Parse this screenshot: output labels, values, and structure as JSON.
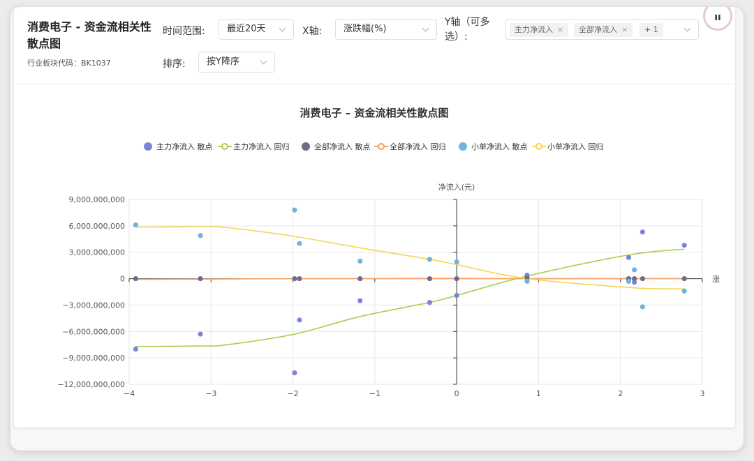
{
  "header": {
    "title": "消费电子 - 资金流相关性散点图",
    "subtitle": "行业板块代码：BK1037",
    "avatar_text": "ıı"
  },
  "filters": {
    "time_label": "时间范围:",
    "time_value": "最近20天",
    "x_label": "X轴:",
    "x_value": "涨跌幅(%)",
    "y_label": "Y轴（可多选）:",
    "y_tags": [
      "主力净流入",
      "全部净流入"
    ],
    "y_more": "+ 1",
    "sort_label": "排序:",
    "sort_value": "按Y降序"
  },
  "colors": {
    "main_scatter": "#7b85d8",
    "main_reg": "#a8cf4e",
    "all_scatter": "#6e6d85",
    "all_reg": "#f4a161",
    "small_scatter": "#6db4de",
    "small_reg": "#f3d651"
  },
  "chart_data": {
    "type": "scatter",
    "title": "消费电子 – 资金流相关性散点图",
    "ylabel": "净流入(元)",
    "xlabel": "涨",
    "xlim": [
      -4,
      3
    ],
    "ylim": [
      -12000000000,
      9000000000
    ],
    "xticks": [
      -4,
      -3,
      -2,
      -1,
      0,
      1,
      2,
      3
    ],
    "xtick_labels": [
      "−4",
      "−3",
      "−2",
      "−1",
      "0",
      "1",
      "2",
      "3"
    ],
    "yticks": [
      9000000000,
      6000000000,
      3000000000,
      0,
      -3000000000,
      -6000000000,
      -9000000000,
      -12000000000
    ],
    "ytick_labels": [
      "9,000,000,000",
      "6,000,000,000",
      "3,000,000,000",
      "0",
      "−3,000,000,000",
      "−6,000,000,000",
      "−9,000,000,000",
      "−12,000,000,000"
    ],
    "grid": true,
    "legend_position": "top-center",
    "legend": [
      "主力净流入 散点",
      "主力净流入 回归",
      "全部净流入 散点",
      "全部净流入 回归",
      "小单净流入 散点",
      "小单净流入 回归"
    ],
    "series": [
      {
        "name": "主力净流入 散点",
        "kind": "scatter",
        "color_key": "main_scatter",
        "points": [
          [
            -3.92,
            -8000000000
          ],
          [
            -3.13,
            -6300000000
          ],
          [
            -1.92,
            -4700000000
          ],
          [
            -1.98,
            -10700000000
          ],
          [
            -1.18,
            -2500000000
          ],
          [
            -0.33,
            -2700000000
          ],
          [
            0.0,
            -1900000000
          ],
          [
            0.86,
            400000000
          ],
          [
            2.1,
            2400000000
          ],
          [
            2.27,
            5300000000
          ],
          [
            2.17,
            -400000000
          ],
          [
            2.78,
            3800000000
          ]
        ]
      },
      {
        "name": "主力净流入 回归",
        "kind": "line",
        "color_key": "main_reg",
        "points": [
          [
            -3.92,
            -7700000000
          ],
          [
            -3.13,
            -7650000000
          ],
          [
            -2.8,
            -7500000000
          ],
          [
            -1.98,
            -6300000000
          ],
          [
            -1.18,
            -4300000000
          ],
          [
            -0.33,
            -2700000000
          ],
          [
            0.0,
            -1900000000
          ],
          [
            0.86,
            300000000
          ],
          [
            2.1,
            2700000000
          ],
          [
            2.78,
            3350000000
          ]
        ]
      },
      {
        "name": "全部净流入 散点",
        "kind": "scatter",
        "color_key": "all_scatter",
        "points": [
          [
            -3.92,
            0
          ],
          [
            -3.13,
            0
          ],
          [
            -1.98,
            0
          ],
          [
            -1.92,
            0
          ],
          [
            -1.18,
            0
          ],
          [
            -0.33,
            0
          ],
          [
            0.0,
            0
          ],
          [
            0.86,
            100000000
          ],
          [
            2.1,
            0
          ],
          [
            2.17,
            0
          ],
          [
            2.27,
            0
          ],
          [
            2.78,
            0
          ]
        ]
      },
      {
        "name": "全部净流入 回归",
        "kind": "line",
        "color_key": "all_reg",
        "points": [
          [
            -3.92,
            -80000000
          ],
          [
            -1.98,
            0
          ],
          [
            0.0,
            30000000
          ],
          [
            0.86,
            0
          ],
          [
            2.78,
            20000000
          ]
        ]
      },
      {
        "name": "小单净流入 散点",
        "kind": "scatter",
        "color_key": "small_scatter",
        "points": [
          [
            -3.92,
            6100000000
          ],
          [
            -3.13,
            4900000000
          ],
          [
            -1.98,
            7800000000
          ],
          [
            -1.92,
            4000000000
          ],
          [
            -1.18,
            2000000000
          ],
          [
            -0.33,
            2200000000
          ],
          [
            0.0,
            1900000000
          ],
          [
            0.86,
            -300000000
          ],
          [
            2.1,
            -300000000
          ],
          [
            2.17,
            1000000000
          ],
          [
            2.27,
            -3200000000
          ],
          [
            2.78,
            -1400000000
          ]
        ]
      },
      {
        "name": "小单净流入 回归",
        "kind": "line",
        "color_key": "small_reg",
        "points": [
          [
            -3.92,
            5850000000
          ],
          [
            -3.13,
            5900000000
          ],
          [
            -2.8,
            5800000000
          ],
          [
            -1.98,
            4800000000
          ],
          [
            -1.18,
            3500000000
          ],
          [
            -0.33,
            2200000000
          ],
          [
            0.0,
            1600000000
          ],
          [
            0.86,
            0
          ],
          [
            2.1,
            -1000000000
          ],
          [
            2.5,
            -1150000000
          ],
          [
            2.78,
            -1150000000
          ]
        ]
      }
    ]
  }
}
